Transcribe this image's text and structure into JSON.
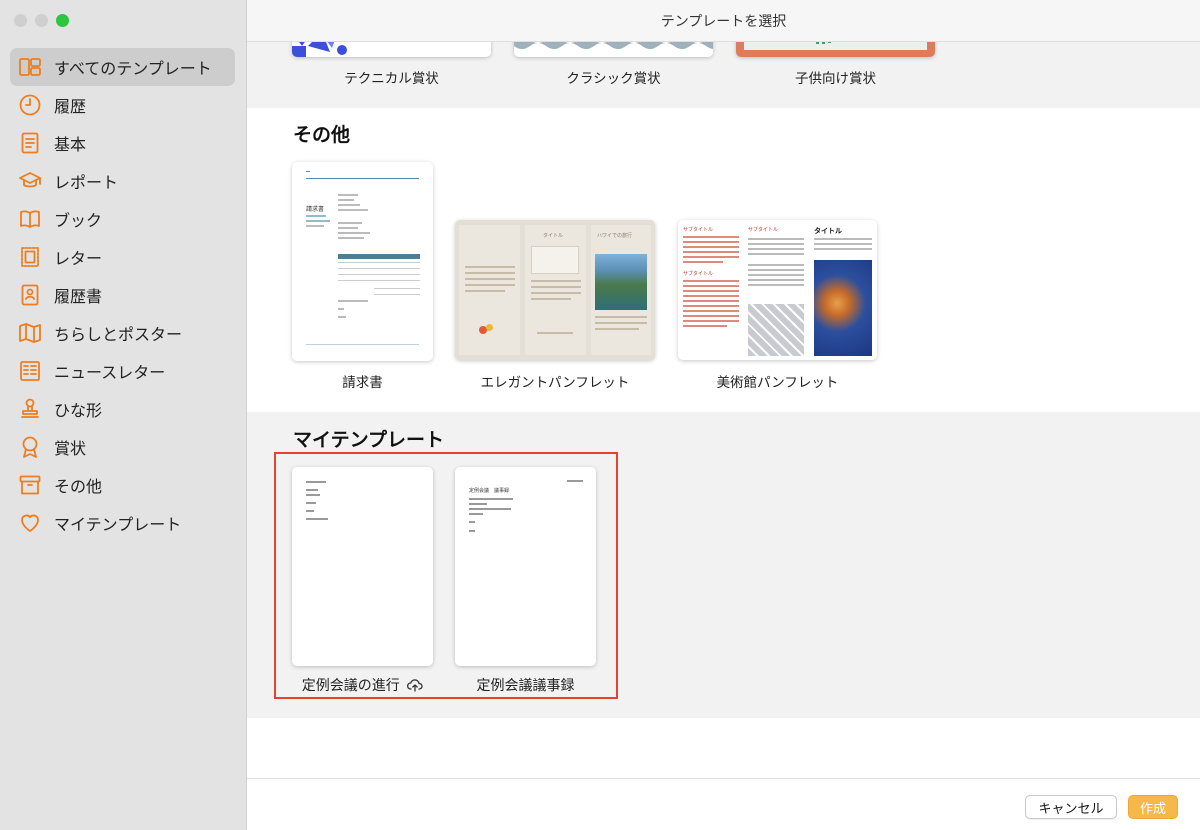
{
  "window": {
    "title": "テンプレートを選択"
  },
  "sidebar": {
    "items": [
      {
        "label": "すべてのテンプレート",
        "icon": "all-templates-icon",
        "selected": true
      },
      {
        "label": "履歴",
        "icon": "clock-icon"
      },
      {
        "label": "基本",
        "icon": "document-icon"
      },
      {
        "label": "レポート",
        "icon": "graduation-cap-icon"
      },
      {
        "label": "ブック",
        "icon": "book-icon"
      },
      {
        "label": "レター",
        "icon": "stamp-icon"
      },
      {
        "label": "履歴書",
        "icon": "resume-icon"
      },
      {
        "label": "ちらしとポスター",
        "icon": "map-icon"
      },
      {
        "label": "ニュースレター",
        "icon": "newsletter-icon"
      },
      {
        "label": "ひな形",
        "icon": "seal-icon"
      },
      {
        "label": "賞状",
        "icon": "award-icon"
      },
      {
        "label": "その他",
        "icon": "archive-box-icon"
      },
      {
        "label": "マイテンプレート",
        "icon": "heart-icon"
      }
    ]
  },
  "sections": {
    "awards": {
      "templates": [
        {
          "label": "テクニカル賞状"
        },
        {
          "label": "クラシック賞状"
        },
        {
          "label": "子供向け賞状"
        }
      ]
    },
    "other": {
      "title": "その他",
      "templates": [
        {
          "label": "請求書"
        },
        {
          "label": "エレガントパンフレット"
        },
        {
          "label": "美術館パンフレット"
        }
      ]
    },
    "my_templates": {
      "title": "マイテンプレート",
      "templates": [
        {
          "label": "定例会議の進行",
          "icon": "cloud-upload-icon"
        },
        {
          "label": "定例会議議事録"
        }
      ]
    }
  },
  "thumb_text": {
    "pamphlet_title": "タイトル",
    "pamphlet_travel": "ハワイでの旅行",
    "museum_subtitle_1": "サブタイトル",
    "museum_subtitle_2": "サブタイトル",
    "museum_subtitle_3": "サブタイトル",
    "museum_title": "タイトル",
    "invoice_title": "請求書",
    "minutes_title": "定例会議　議事録"
  },
  "footer": {
    "cancel": "キャンセル",
    "create": "作成"
  },
  "colors": {
    "accent": "#ee7d1f",
    "create_button": "#f6b84a",
    "highlight": "#e2452c"
  }
}
